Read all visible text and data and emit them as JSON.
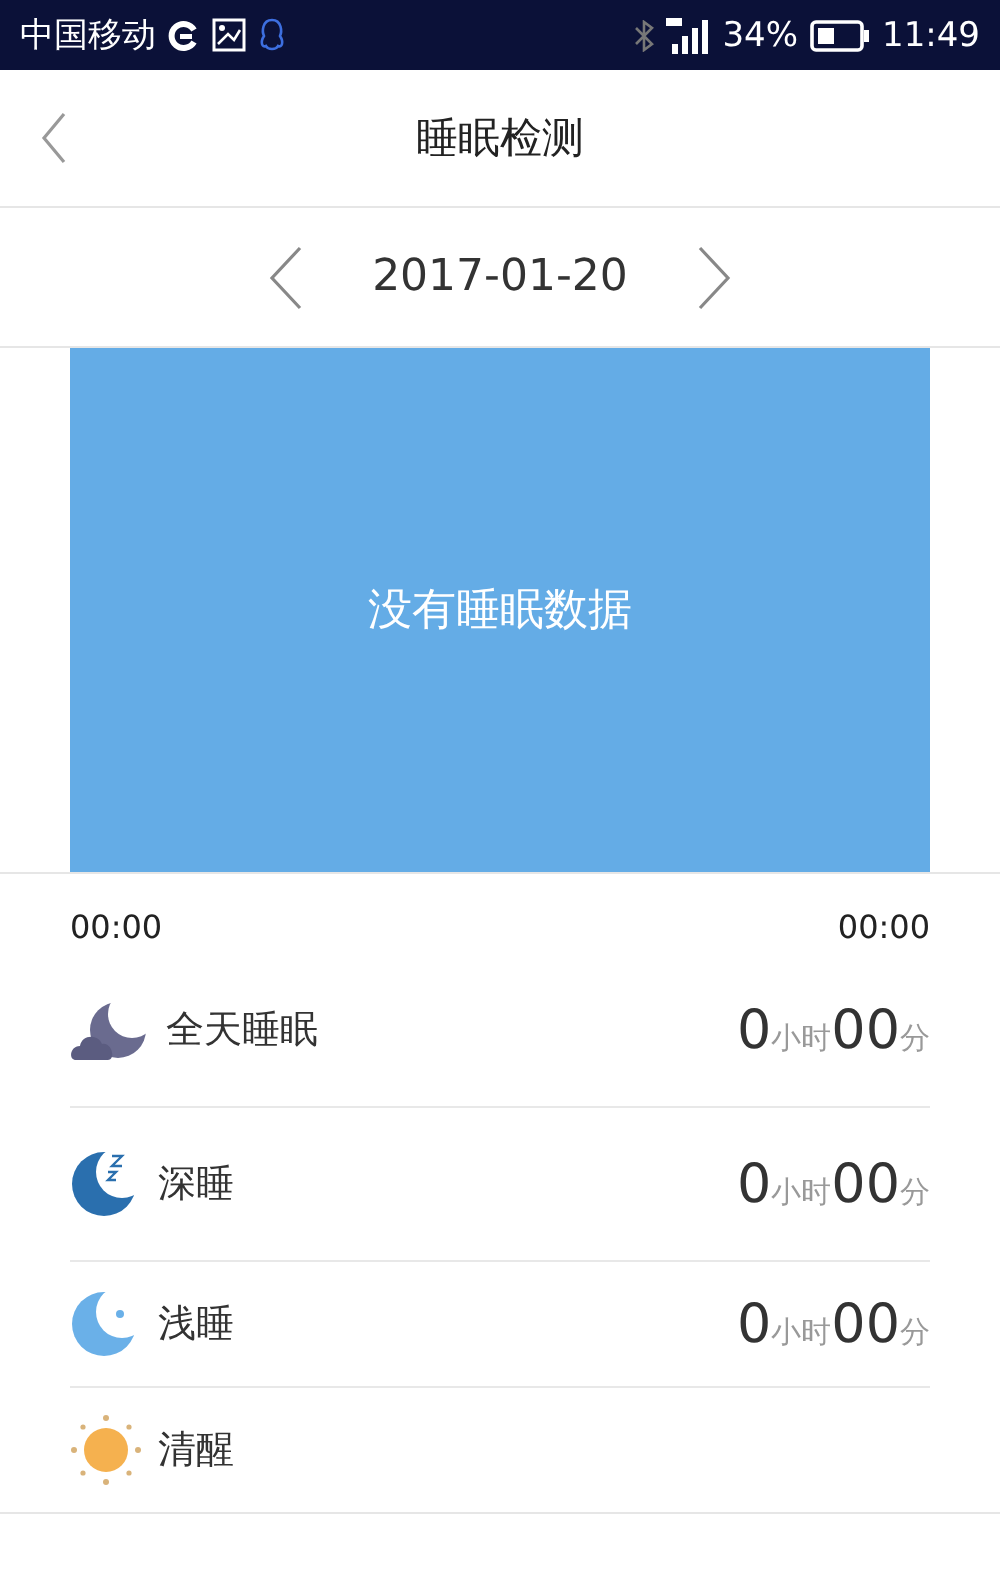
{
  "status_bar": {
    "carrier": "中国移动",
    "battery": "34%",
    "time": "11:49"
  },
  "header": {
    "title": "睡眠检测"
  },
  "date_nav": {
    "date": "2017-01-20"
  },
  "chart": {
    "empty_message": "没有睡眠数据",
    "start_time": "00:00",
    "end_time": "00:00"
  },
  "stats": [
    {
      "kind": "all-day",
      "label": "全天睡眠",
      "hours": "0",
      "hours_unit": "小时",
      "minutes": "00",
      "minutes_unit": "分"
    },
    {
      "kind": "deep",
      "label": "深睡",
      "hours": "0",
      "hours_unit": "小时",
      "minutes": "00",
      "minutes_unit": "分"
    },
    {
      "kind": "light",
      "label": "浅睡",
      "hours": "0",
      "hours_unit": "小时",
      "minutes": "00",
      "minutes_unit": "分"
    },
    {
      "kind": "awake",
      "label": "清醒"
    }
  ]
}
